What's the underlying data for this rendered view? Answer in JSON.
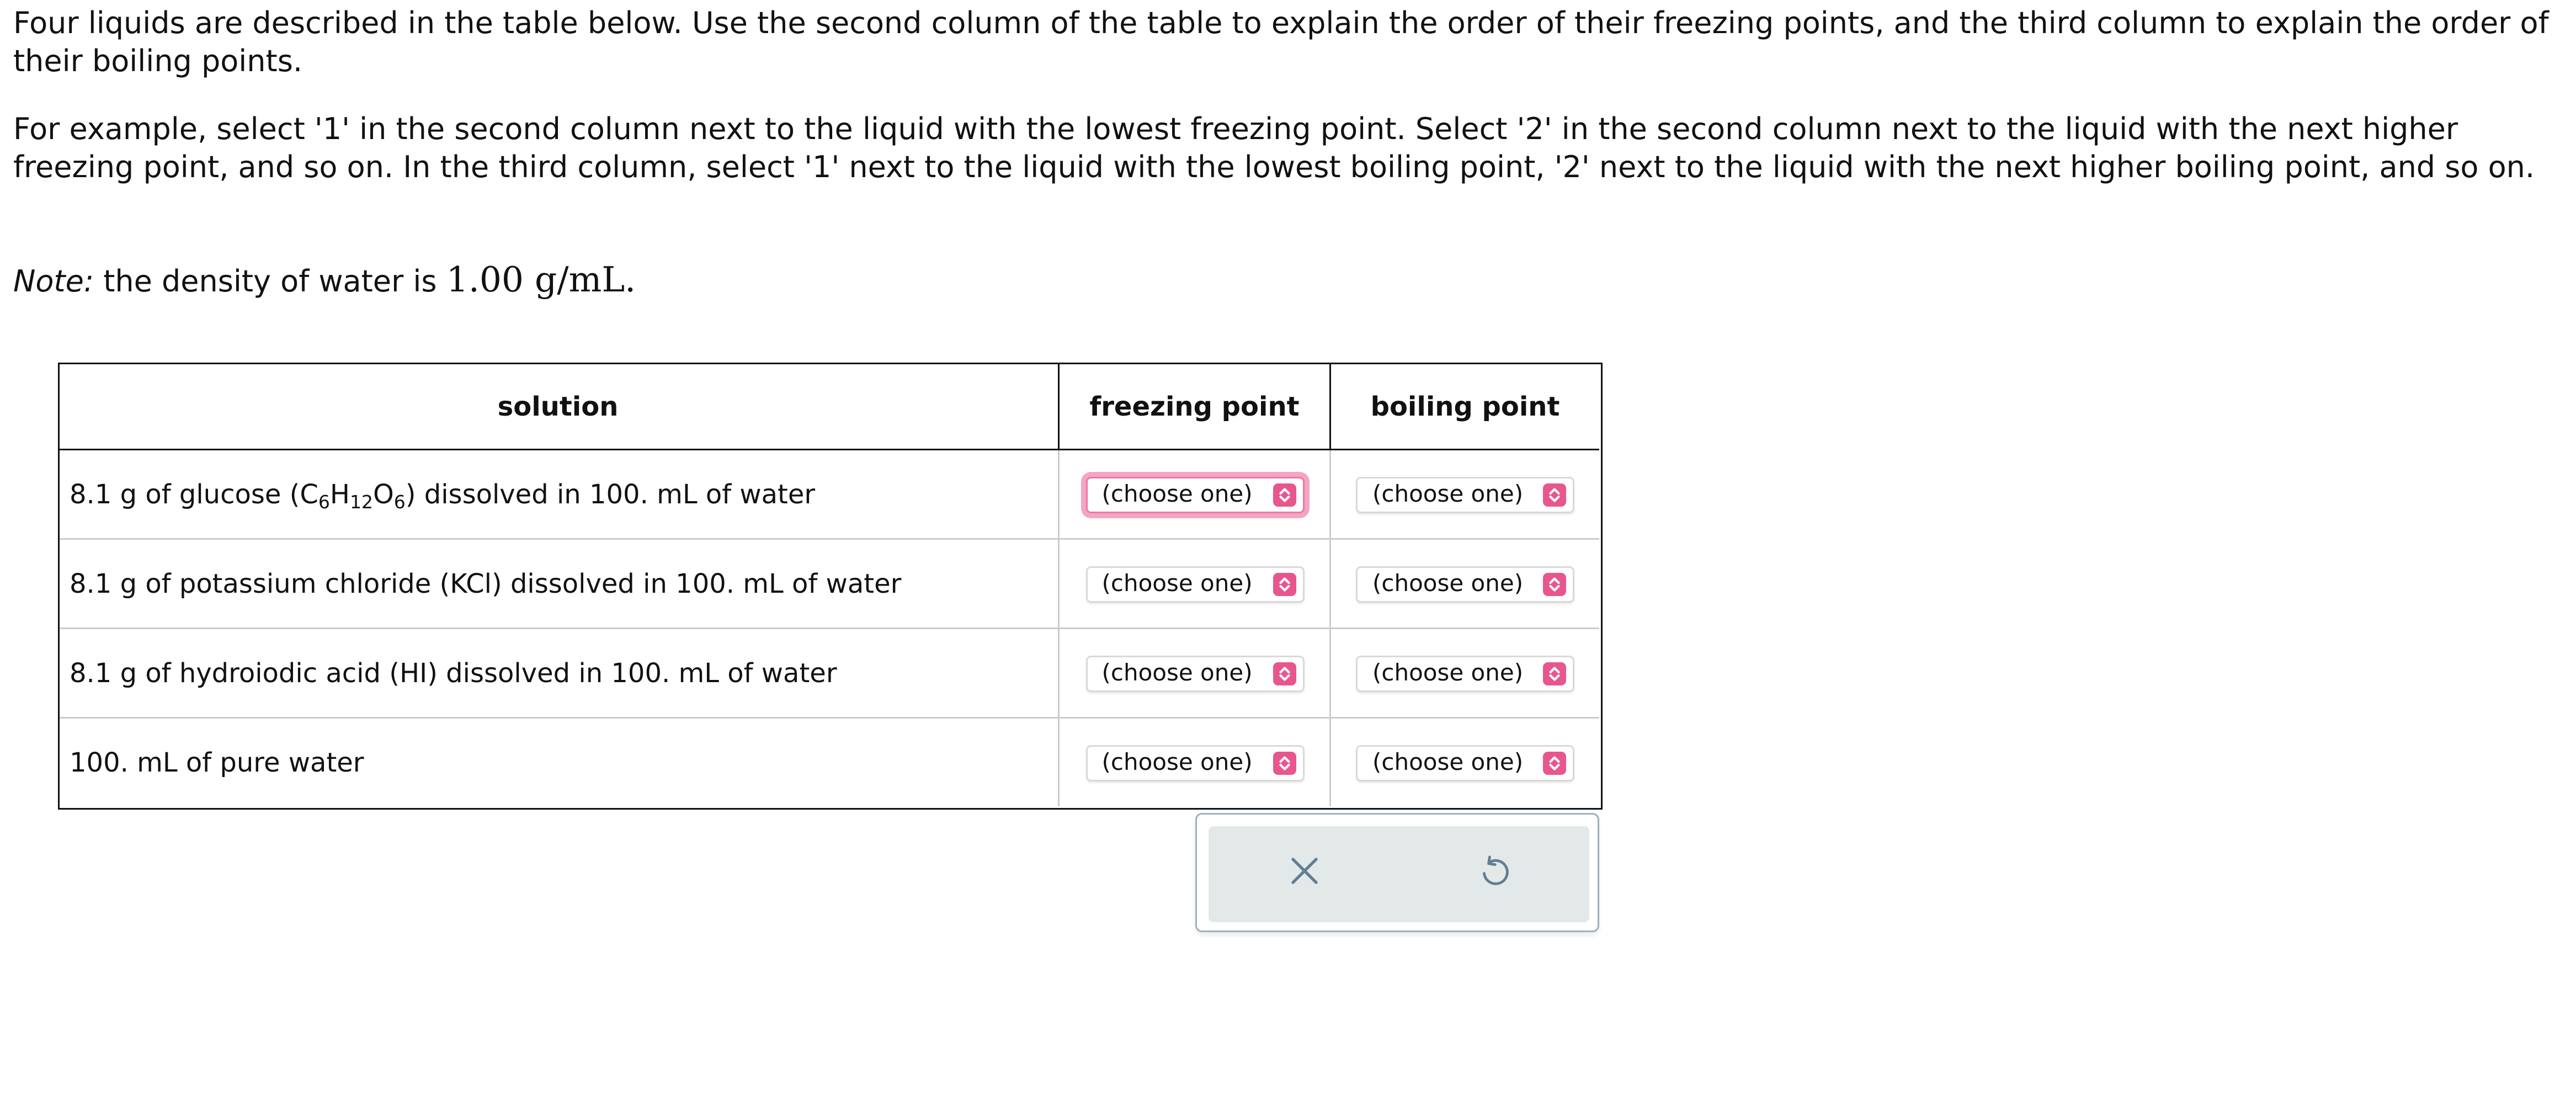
{
  "instructions": {
    "p1": "Four liquids are described in the table below. Use the second column of the table to explain the order of their freezing points, and the third column to explain the order of their boiling points.",
    "p2": "For example, select '1' in the second column next to the liquid with the lowest freezing point. Select '2' in the second column next to the liquid with the next higher freezing point, and so on. In the third column, select '1' next to the liquid with the lowest boiling point, '2' next to the liquid with the next higher boiling point, and so on.",
    "note_label": "Note:",
    "note_text": " the density of water is ",
    "note_value": "1.00 g/mL."
  },
  "table": {
    "headers": [
      "solution",
      "freezing point",
      "boiling point"
    ],
    "rows": [
      {
        "pre": "8.1 g of glucose (C",
        "sub1": "6",
        "mid1": "H",
        "sub2": "12",
        "mid2": "O",
        "sub3": "6",
        "post": ") dissolved in 100. mL of water",
        "freezing": "(choose one)",
        "boiling": "(choose one)"
      },
      {
        "text": "8.1 g of potassium chloride (KCl) dissolved in 100. mL of water",
        "freezing": "(choose one)",
        "boiling": "(choose one)"
      },
      {
        "text": "8.1 g of hydroiodic acid (HI) dissolved in 100. mL of water",
        "freezing": "(choose one)",
        "boiling": "(choose one)"
      },
      {
        "text": "100. mL of pure water",
        "freezing": "(choose one)",
        "boiling": "(choose one)"
      }
    ]
  },
  "actions": {
    "clear_icon": "close-icon",
    "undo_icon": "undo-icon"
  },
  "colors": {
    "select_accent": "#e8568e",
    "focus_ring": "#f4a5c2",
    "panel_bg": "#e3e9e8",
    "icon_color": "#5f7f93"
  }
}
